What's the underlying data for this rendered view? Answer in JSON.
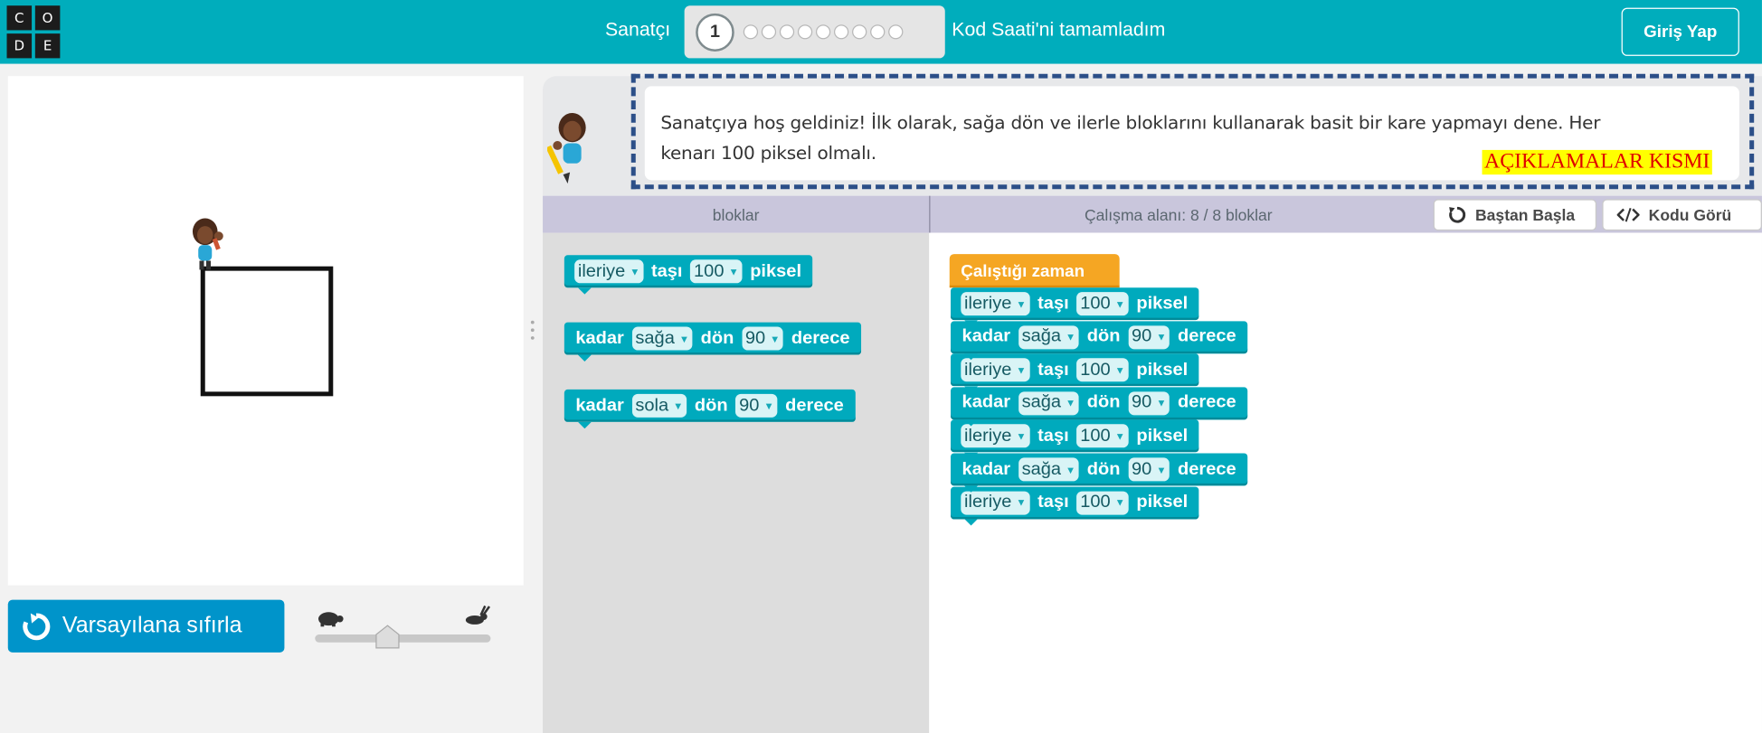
{
  "header": {
    "logo_letters": [
      "C",
      "O",
      "D",
      "E"
    ],
    "title": "Sanatçı",
    "current_level": "1",
    "remaining_levels": 9,
    "hour_complete": "Kod Saati'ni tamamladım",
    "login_label": "Giriş Yap",
    "bar_color": "#00adbc"
  },
  "canvas": {
    "reset_label": "Varsayılana sıfırla",
    "speed_slider_level": 0.4,
    "speed_icons": [
      "turtle-icon",
      "rabbit-icon"
    ]
  },
  "instructions": {
    "text_line1": "Sanatçıya hoş geldiniz! İlk olarak, sağa dön ve ilerle bloklarını kullanarak basit bir kare yapmayı dene. Her",
    "text_line2": "kenarı 100 piksel olmalı.",
    "annotation_label": "AÇIKLAMALAR KISMI"
  },
  "workspace_header": {
    "toolbox_label": "bloklar",
    "workspace_label": "Çalışma alanı: 8 / 8 bloklar",
    "restart_label": "Baştan Başla",
    "show_code_label": "Kodu Görü"
  },
  "toolbox": {
    "move": {
      "dir": "ileriye",
      "word1": "taşı",
      "amount": "100",
      "unit": "piksel"
    },
    "turn_right": {
      "prefix": "kadar",
      "dir": "sağa",
      "word1": "dön",
      "amount": "90",
      "unit": "derece"
    },
    "turn_left": {
      "prefix": "kadar",
      "dir": "sola",
      "word1": "dön",
      "amount": "90",
      "unit": "derece"
    }
  },
  "program": {
    "start_label": "Çalıştığı zaman",
    "blocks": [
      {
        "type": "move",
        "dir": "ileriye",
        "word1": "taşı",
        "amount": "100",
        "unit": "piksel"
      },
      {
        "type": "turn",
        "prefix": "kadar",
        "dir": "sağa",
        "word1": "dön",
        "amount": "90",
        "unit": "derece"
      },
      {
        "type": "move",
        "dir": "ileriye",
        "word1": "taşı",
        "amount": "100",
        "unit": "piksel"
      },
      {
        "type": "turn",
        "prefix": "kadar",
        "dir": "sağa",
        "word1": "dön",
        "amount": "90",
        "unit": "derece"
      },
      {
        "type": "move",
        "dir": "ileriye",
        "word1": "taşı",
        "amount": "100",
        "unit": "piksel"
      },
      {
        "type": "turn",
        "prefix": "kadar",
        "dir": "sağa",
        "word1": "dön",
        "amount": "90",
        "unit": "derece"
      },
      {
        "type": "move",
        "dir": "ileriye",
        "word1": "taşı",
        "amount": "100",
        "unit": "piksel"
      }
    ]
  }
}
